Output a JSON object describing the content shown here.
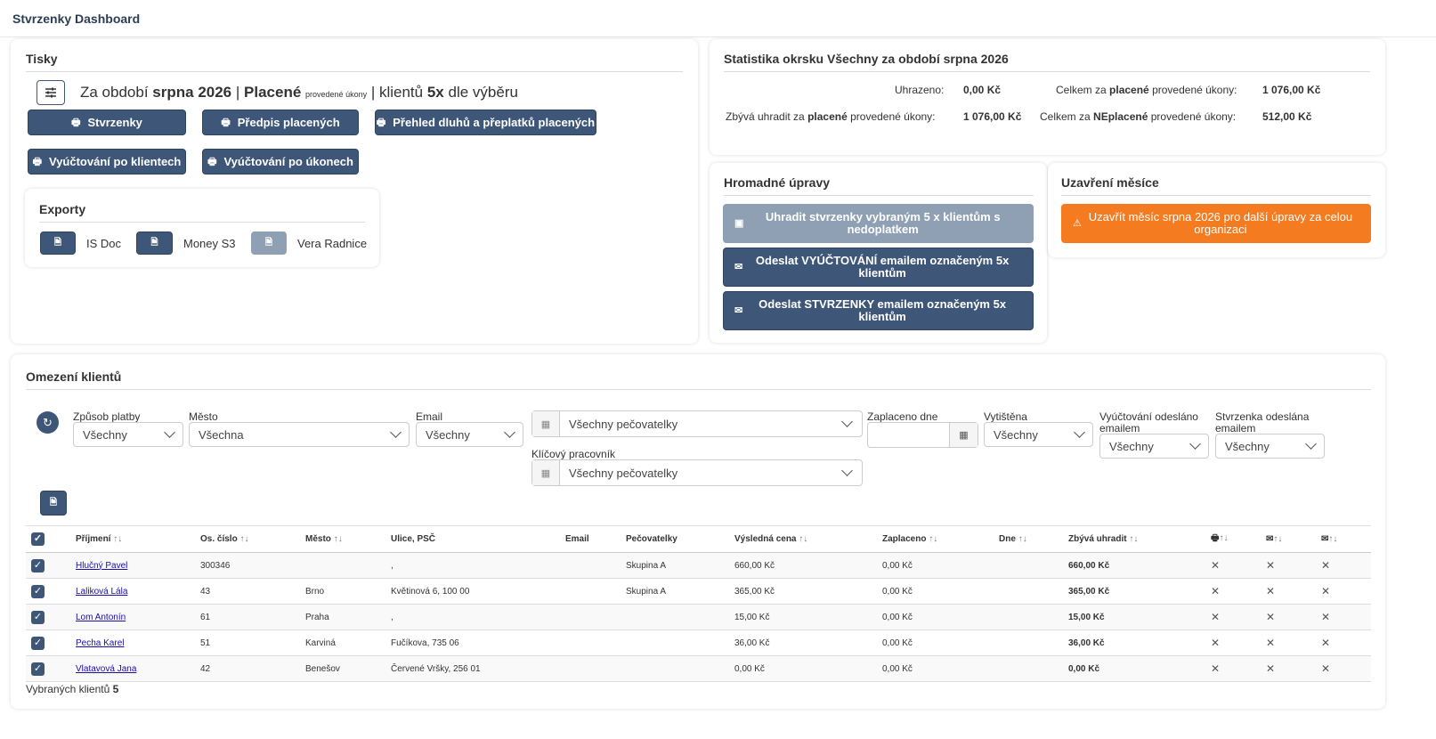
{
  "app_title": "Stvrzenky Dashboard",
  "tisky": {
    "title": "Tisky",
    "period_prefix": "Za období",
    "period": "srpna 2026",
    "sep": "|",
    "mode": "Placené",
    "mode_small": "provedené úkony",
    "clients_text": "| klientů",
    "clients_count": "5x",
    "clients_suffix": "dle výběru",
    "buttons": [
      "Stvrzenky",
      "Předpis placených",
      "Přehled dluhů a přeplatků placených",
      "Vyúčtování po klientech",
      "Vyúčtování po úkonech"
    ]
  },
  "exporty": {
    "title": "Exporty",
    "items": [
      "IS Doc",
      "Money S3",
      "Vera Radnice"
    ]
  },
  "stats": {
    "title": "Statistika okrsku Všechny za období srpna 2026",
    "uhrazeno_label": "Uhrazeno:",
    "uhrazeno_value": "0,00 Kč",
    "celkem_placene_pre": "Celkem za",
    "celkem_placene_bold": "placené",
    "celkem_placene_post": "provedené úkony:",
    "celkem_placene_value": "1 076,00 Kč",
    "zbyva_pre": "Zbývá uhradit za",
    "zbyva_bold": "placené",
    "zbyva_post": "provedené úkony:",
    "zbyva_value": "1 076,00 Kč",
    "celkem_neplacene_pre": "Celkem za",
    "celkem_neplacene_bold": "NEplacené",
    "celkem_neplacene_post": "provedené úkony:",
    "celkem_neplacene_value": "512,00 Kč"
  },
  "hromadne": {
    "title": "Hromadné úpravy",
    "btn1": "Uhradit stvrzenky vybraným 5 x klientům s nedoplatkem",
    "btn2": "Odeslat VYÚČTOVÁNÍ emailem označeným 5x klientům",
    "btn3": "Odeslat STVRZENKY emailem označeným 5x klientům"
  },
  "uzavreni": {
    "title": "Uzavření měsíce",
    "btn": "Uzavřít měsíc srpna 2026 pro další úpravy za celou organizaci"
  },
  "omezeni": {
    "title": "Omezení klientů",
    "filters": {
      "zpusob_label": "Způsob platby",
      "zpusob_value": "Všechny",
      "mesto_label": "Město",
      "mesto_value": "Všechna",
      "email_label": "Email",
      "email_value": "Všechny",
      "pecovatelky_value": "Všechny pečovatelky",
      "klicovy_label": "Klíčový pracovník",
      "klicovy_value": "Všechny pečovatelky",
      "zaplaceno_label": "Zaplaceno dne",
      "zaplaceno_value": "",
      "vytistena_label": "Vytištěna",
      "vytistena_value": "Všechny",
      "vyuct_label": "Vyúčtování odesláno emailem",
      "vyuct_value": "Všechny",
      "stvrz_label": "Stvrzenka odeslána emailem",
      "stvrz_value": "Všechny"
    }
  },
  "table": {
    "headers": [
      "Příjmení",
      "Os. číslo",
      "Město",
      "Ulice, PSČ",
      "Email",
      "Pečovatelky",
      "Výsledná cena",
      "Zaplaceno",
      "Dne",
      "Zbývá uhradit"
    ],
    "rows": [
      {
        "name": "Hlučný Pavel",
        "os": "300346",
        "mesto": "",
        "ulice": ",",
        "email": "",
        "pec": "Skupina A",
        "cena": "660,00 Kč",
        "zapl": "0,00 Kč",
        "dne": "",
        "zbyva": "660,00 Kč"
      },
      {
        "name": "Laliková Lála",
        "os": "43",
        "mesto": "Brno",
        "ulice": "Květinová 6, 100 00",
        "email": "",
        "pec": "Skupina A",
        "cena": "365,00 Kč",
        "zapl": "0,00 Kč",
        "dne": "",
        "zbyva": "365,00 Kč"
      },
      {
        "name": "Lom Antonín",
        "os": "61",
        "mesto": "Praha",
        "ulice": ",",
        "email": "",
        "pec": "",
        "cena": "15,00 Kč",
        "zapl": "0,00 Kč",
        "dne": "",
        "zbyva": "15,00 Kč"
      },
      {
        "name": "Pecha Karel",
        "os": "51",
        "mesto": "Karviná",
        "ulice": "Fučíkova, 735 06",
        "email": "",
        "pec": "",
        "cena": "36,00 Kč",
        "zapl": "0,00 Kč",
        "dne": "",
        "zbyva": "36,00 Kč"
      },
      {
        "name": "Vlatavová Jana",
        "os": "42",
        "mesto": "Benešov",
        "ulice": "Červené Vršky, 256 01",
        "email": "",
        "pec": "",
        "cena": "0,00 Kč",
        "zapl": "0,00 Kč",
        "dne": "",
        "zbyva": "0,00 Kč"
      }
    ],
    "footer_label": "Vybraných klientů",
    "footer_count": "5"
  },
  "colors": {
    "primary": "#3e5779",
    "disabled": "#8f9fb4",
    "warning": "#f47b20"
  }
}
